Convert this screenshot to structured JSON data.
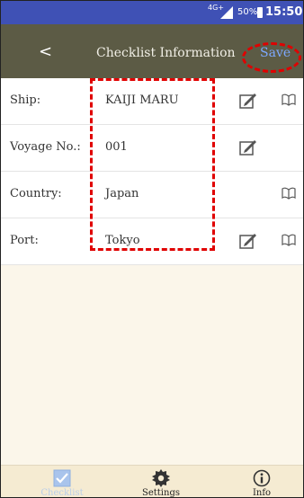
{
  "status_bar": {
    "network": "4G+",
    "battery": "50%",
    "time": "15:50"
  },
  "toolbar": {
    "back_label": "<",
    "title": "Checklist Information",
    "save_label": "Save"
  },
  "rows": [
    {
      "label": "Ship:",
      "value": "KAIJI MARU",
      "edit": true,
      "book": true
    },
    {
      "label": "Voyage No.:",
      "value": "001",
      "edit": true,
      "book": false
    },
    {
      "label": "Country:",
      "value": "Japan",
      "edit": false,
      "book": true
    },
    {
      "label": "Port:",
      "value": "Tokyo",
      "edit": true,
      "book": true
    }
  ],
  "bottom_nav": {
    "items": [
      {
        "label": "Checklist",
        "icon": "checkbox-icon",
        "active": true
      },
      {
        "label": "Settings",
        "icon": "gear-icon",
        "active": false
      },
      {
        "label": "Info",
        "icon": "info-icon",
        "active": false
      }
    ]
  },
  "colors": {
    "status_bar": "#3f51b5",
    "toolbar": "#5c5b45",
    "save_link": "#7da8ff",
    "annotation": "#e00000",
    "nav_bg": "#f5ebd2"
  }
}
